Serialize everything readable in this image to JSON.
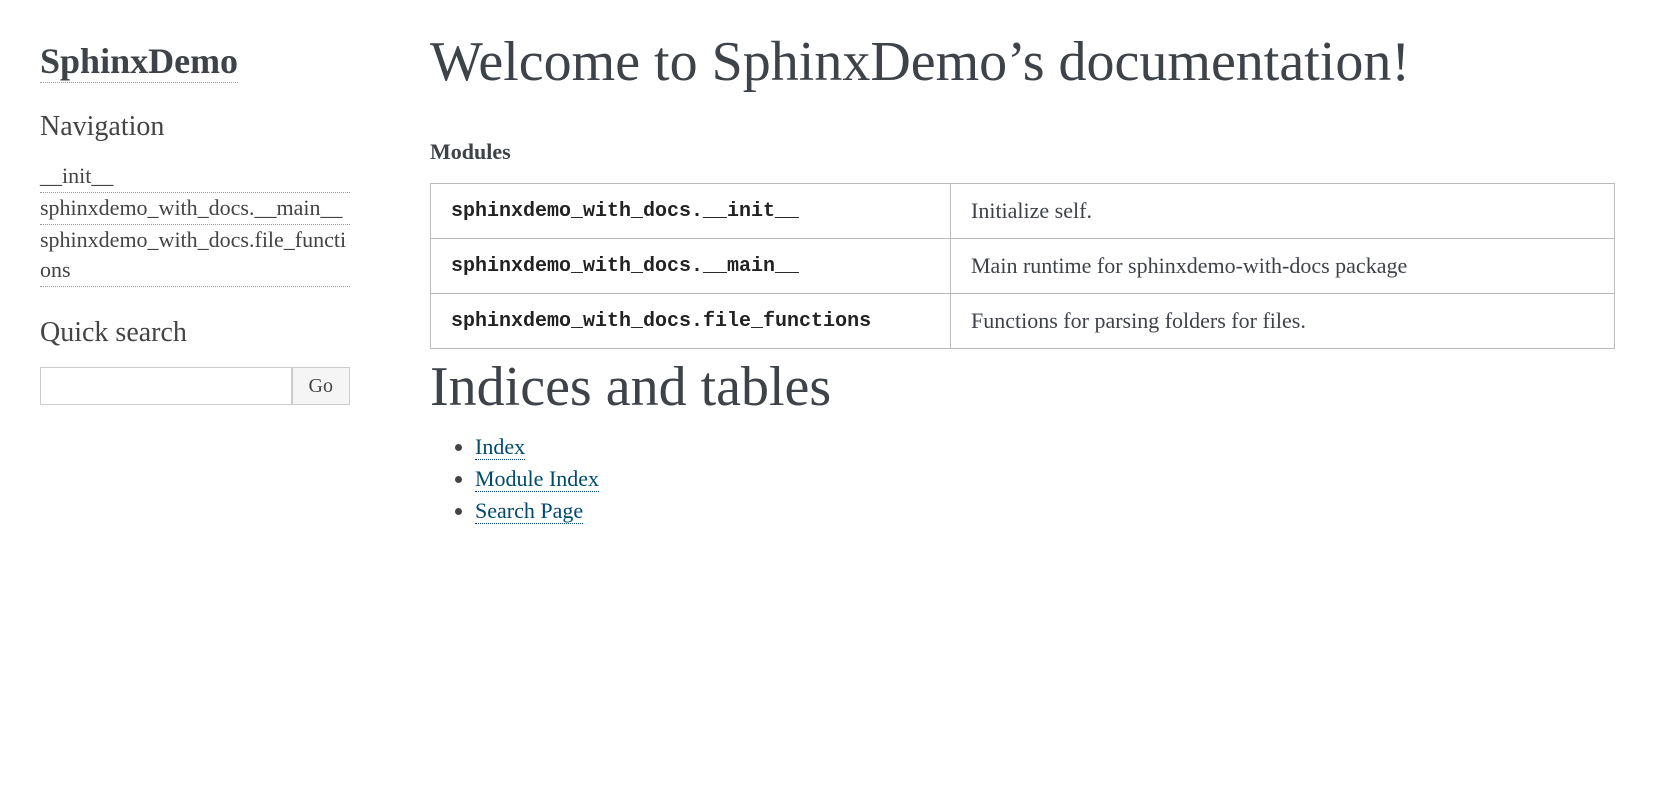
{
  "sidebar": {
    "site_title": "SphinxDemo",
    "nav_heading": "Navigation",
    "nav_items": [
      "__init__",
      "sphinxdemo_with_docs.__main__",
      "sphinxdemo_with_docs.file_functions"
    ],
    "search_heading": "Quick search",
    "search_placeholder": "",
    "search_go": "Go"
  },
  "main": {
    "title": "Welcome to SphinxDemo’s documentation!",
    "modules_label": "Modules",
    "modules": [
      {
        "name": "sphinxdemo_with_docs.__init__",
        "desc": "Initialize self."
      },
      {
        "name": "sphinxdemo_with_docs.__main__",
        "desc": "Main runtime for sphinxdemo-with-docs package"
      },
      {
        "name": "sphinxdemo_with_docs.file_functions",
        "desc": "Functions for parsing folders for files."
      }
    ],
    "indices_heading": "Indices and tables",
    "indices": [
      "Index",
      "Module Index",
      "Search Page"
    ]
  }
}
